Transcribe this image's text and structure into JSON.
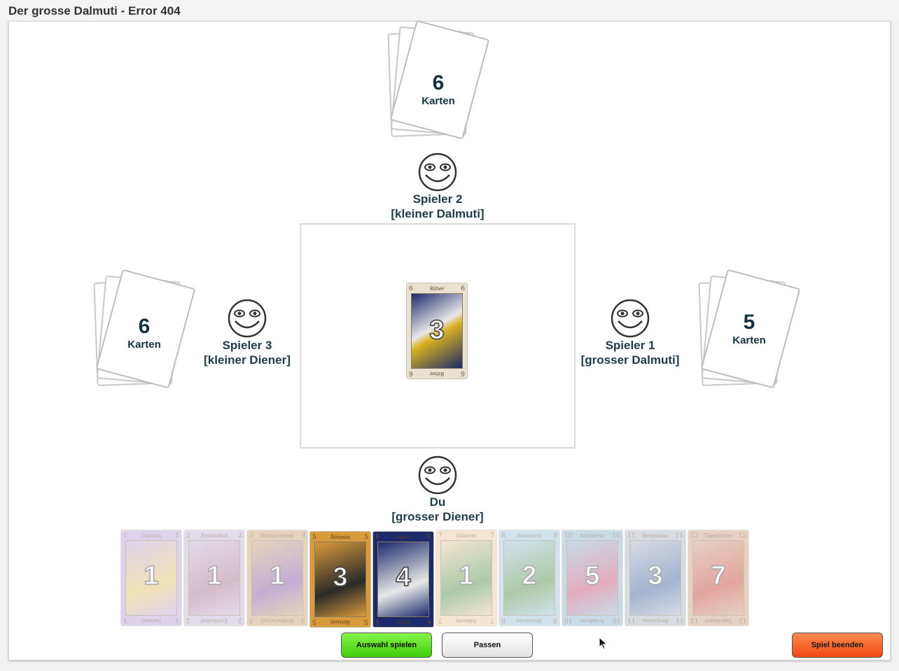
{
  "window": {
    "title": "Der grosse Dalmuti - Error 404"
  },
  "stacks": {
    "top": {
      "count": "6",
      "label": "Karten"
    },
    "left": {
      "count": "6",
      "label": "Karten"
    },
    "right": {
      "count": "5",
      "label": "Karten"
    }
  },
  "players": {
    "p2": {
      "name": "Spieler 2",
      "role": "[kleiner Dalmuti]"
    },
    "p3": {
      "name": "Spieler 3",
      "role": "[kleiner Diener]"
    },
    "p1": {
      "name": "Spieler 1",
      "role": "[grosser Dalmuti]"
    },
    "me": {
      "name": "Du",
      "role": "[grosser Diener]"
    }
  },
  "played_card": {
    "title": "Ritter",
    "rank": "6",
    "count": "3",
    "colors": [
      "#1c2a6b",
      "#e8e8e8",
      "#d8b020"
    ]
  },
  "hand": [
    {
      "title": "Dalmuti",
      "rank": "1",
      "count": "1",
      "active": false,
      "colors": [
        "#b7a0d8",
        "#e0c060"
      ]
    },
    {
      "title": "Erzbischof",
      "rank": "2",
      "count": "1",
      "active": false,
      "colors": [
        "#c0b0d0",
        "#a36a8a"
      ]
    },
    {
      "title": "Hofmarschall",
      "rank": "3",
      "count": "1",
      "active": false,
      "colors": [
        "#c8a070",
        "#7a4ea0"
      ]
    },
    {
      "title": "Äbtissin",
      "rank": "5",
      "count": "3",
      "active": true,
      "colors": [
        "#d89a3a",
        "#2a2a2a"
      ]
    },
    {
      "title": "Ritter",
      "rank": "6",
      "count": "4",
      "active": true,
      "colors": [
        "#1c2a6b",
        "#e8e8e8"
      ]
    },
    {
      "title": "Näherin",
      "rank": "7",
      "count": "1",
      "active": false,
      "colors": [
        "#e8c89a",
        "#4a8a40"
      ]
    },
    {
      "title": "Steinmetz",
      "rank": "8",
      "count": "2",
      "active": false,
      "colors": [
        "#9ac0d8",
        "#4a8a40"
      ]
    },
    {
      "title": "Schäferin",
      "rank": "10",
      "count": "5",
      "active": false,
      "colors": [
        "#8ab0c8",
        "#c04a70"
      ]
    },
    {
      "title": "Bergmann",
      "rank": "11",
      "count": "3",
      "active": false,
      "colors": [
        "#a8b0c0",
        "#3a5a9a"
      ]
    },
    {
      "title": "Tagelöhner",
      "rank": "12",
      "count": "7",
      "active": false,
      "colors": [
        "#c89a7a",
        "#c03a2a"
      ]
    }
  ],
  "buttons": {
    "play": "Auswahl spielen",
    "pass": "Passen",
    "end": "Spiel beenden"
  }
}
